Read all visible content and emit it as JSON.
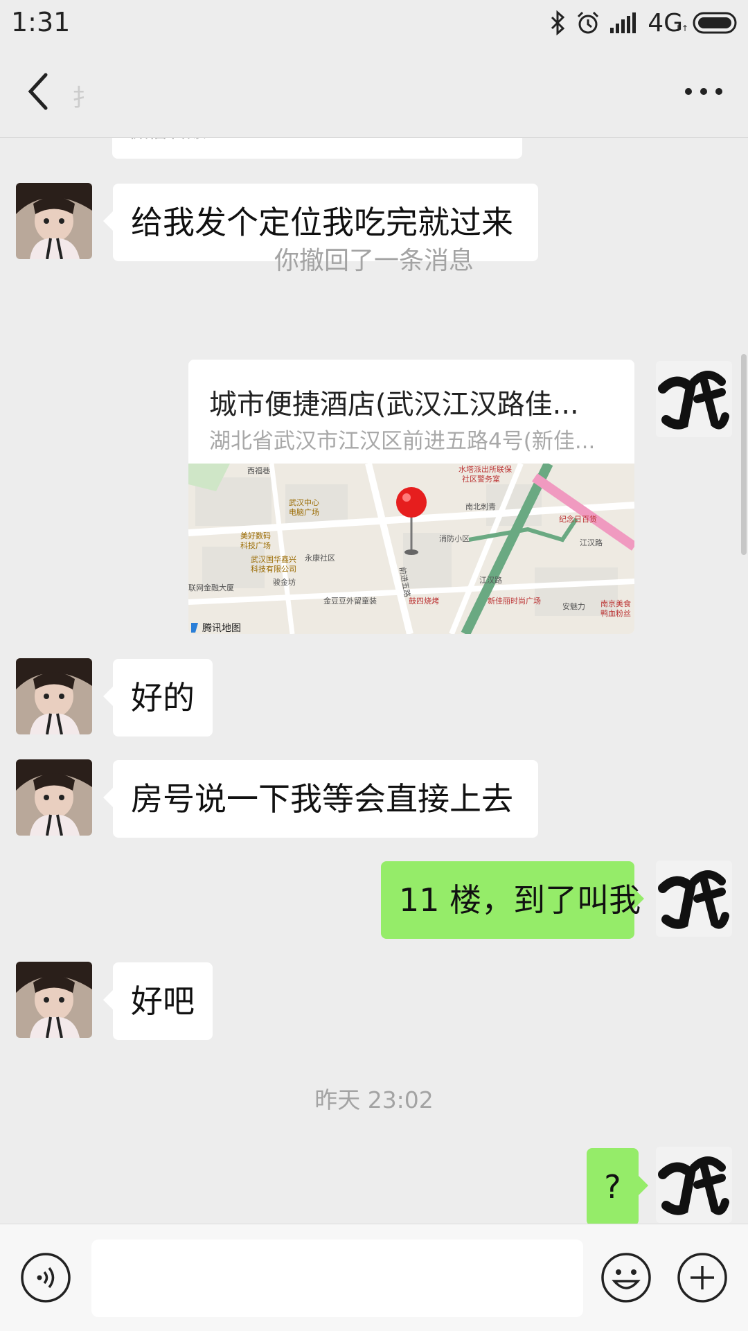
{
  "status": {
    "time": "1:31",
    "network": "4G"
  },
  "nav": {
    "title": "扌",
    "back_icon": "chevron-left-icon",
    "more_icon": "more-dots-icon"
  },
  "messages": {
    "transfer_label": "微信转账",
    "m1": "给我发个定位我吃完就过来",
    "recall_notice": "你撤回了一条消息",
    "location": {
      "name": "城市便捷酒店(武汉江汉路佳...",
      "address": "湖北省武汉市江汉区前进五路4号(新佳...",
      "provider": "腾讯地图",
      "labels": [
        "西福巷",
        "水塔派出所联保",
        "社区警务室",
        "武汉中心",
        "电脑广场",
        "南北刺青",
        "美好数码",
        "科技广场",
        "消防小区",
        "纪念日百货",
        "江汉路",
        "武汉国华鑫兴",
        "科技有限公司",
        "永康社区",
        "前进五路",
        "骏金坊",
        "联网金融大厦",
        "金豆豆外留童装",
        "鼓四烧烤",
        "新佳丽时尚广场",
        "安魅力",
        "南京美食",
        "鸭血粉丝",
        "江汉路"
      ]
    },
    "m2": "好的",
    "m3": "房号说一下我等会直接上去",
    "m4": "11 楼，到了叫我",
    "m5": "好吧",
    "timestamp": "昨天 23:02",
    "m6": "?"
  },
  "input": {
    "value": "",
    "voice_icon": "voice-icon",
    "emoji_icon": "emoji-icon",
    "plus_icon": "plus-icon"
  },
  "colors": {
    "background": "#ededed",
    "sent_bubble": "#95ec69",
    "received_bubble": "#ffffff",
    "system_text": "#a3a3a3"
  }
}
